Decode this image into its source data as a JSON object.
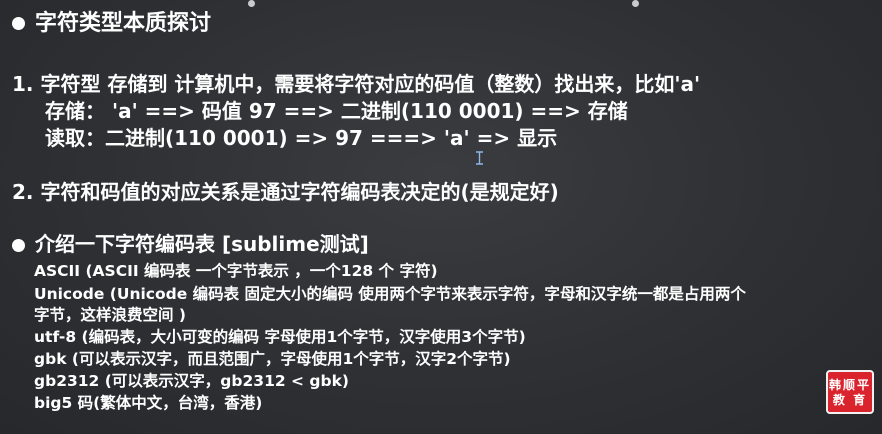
{
  "section1": {
    "title": "字符类型本质探讨"
  },
  "point1": {
    "line1": "1.  字符型 存储到 计算机中，需要将字符对应的码值（整数）找出来，比如'a'",
    "line2": "存储： 'a' ==> 码值 97 ==> 二进制(110 0001) ==> 存储",
    "line3": "读取：二进制(110 0001) => 97 ===> 'a' => 显示"
  },
  "point2": {
    "line1": "2. 字符和码值的对应关系是通过字符编码表决定的(是规定好)"
  },
  "section2": {
    "title": "介绍一下字符编码表 [sublime测试]",
    "items": [
      "ASCII (ASCII 编码表 一个字节表示 ，一个128 个 字符)",
      "Unicode (Unicode 编码表 固定大小的编码 使用两个字节来表示字符，字母和汉字统一都是占用两个",
      "字节，这样浪费空间 )",
      "utf-8 (编码表，大小可变的编码 字母使用1个字节，汉字使用3个字节)",
      "gbk (可以表示汉字，而且范围广，字母使用1个字节，汉字2个字节)",
      "gb2312 (可以表示汉字，gb2312 < gbk)",
      "big5 码(繁体中文，台湾，香港)"
    ]
  },
  "logo": {
    "line1": "韩顺平",
    "line2": "教 育"
  }
}
